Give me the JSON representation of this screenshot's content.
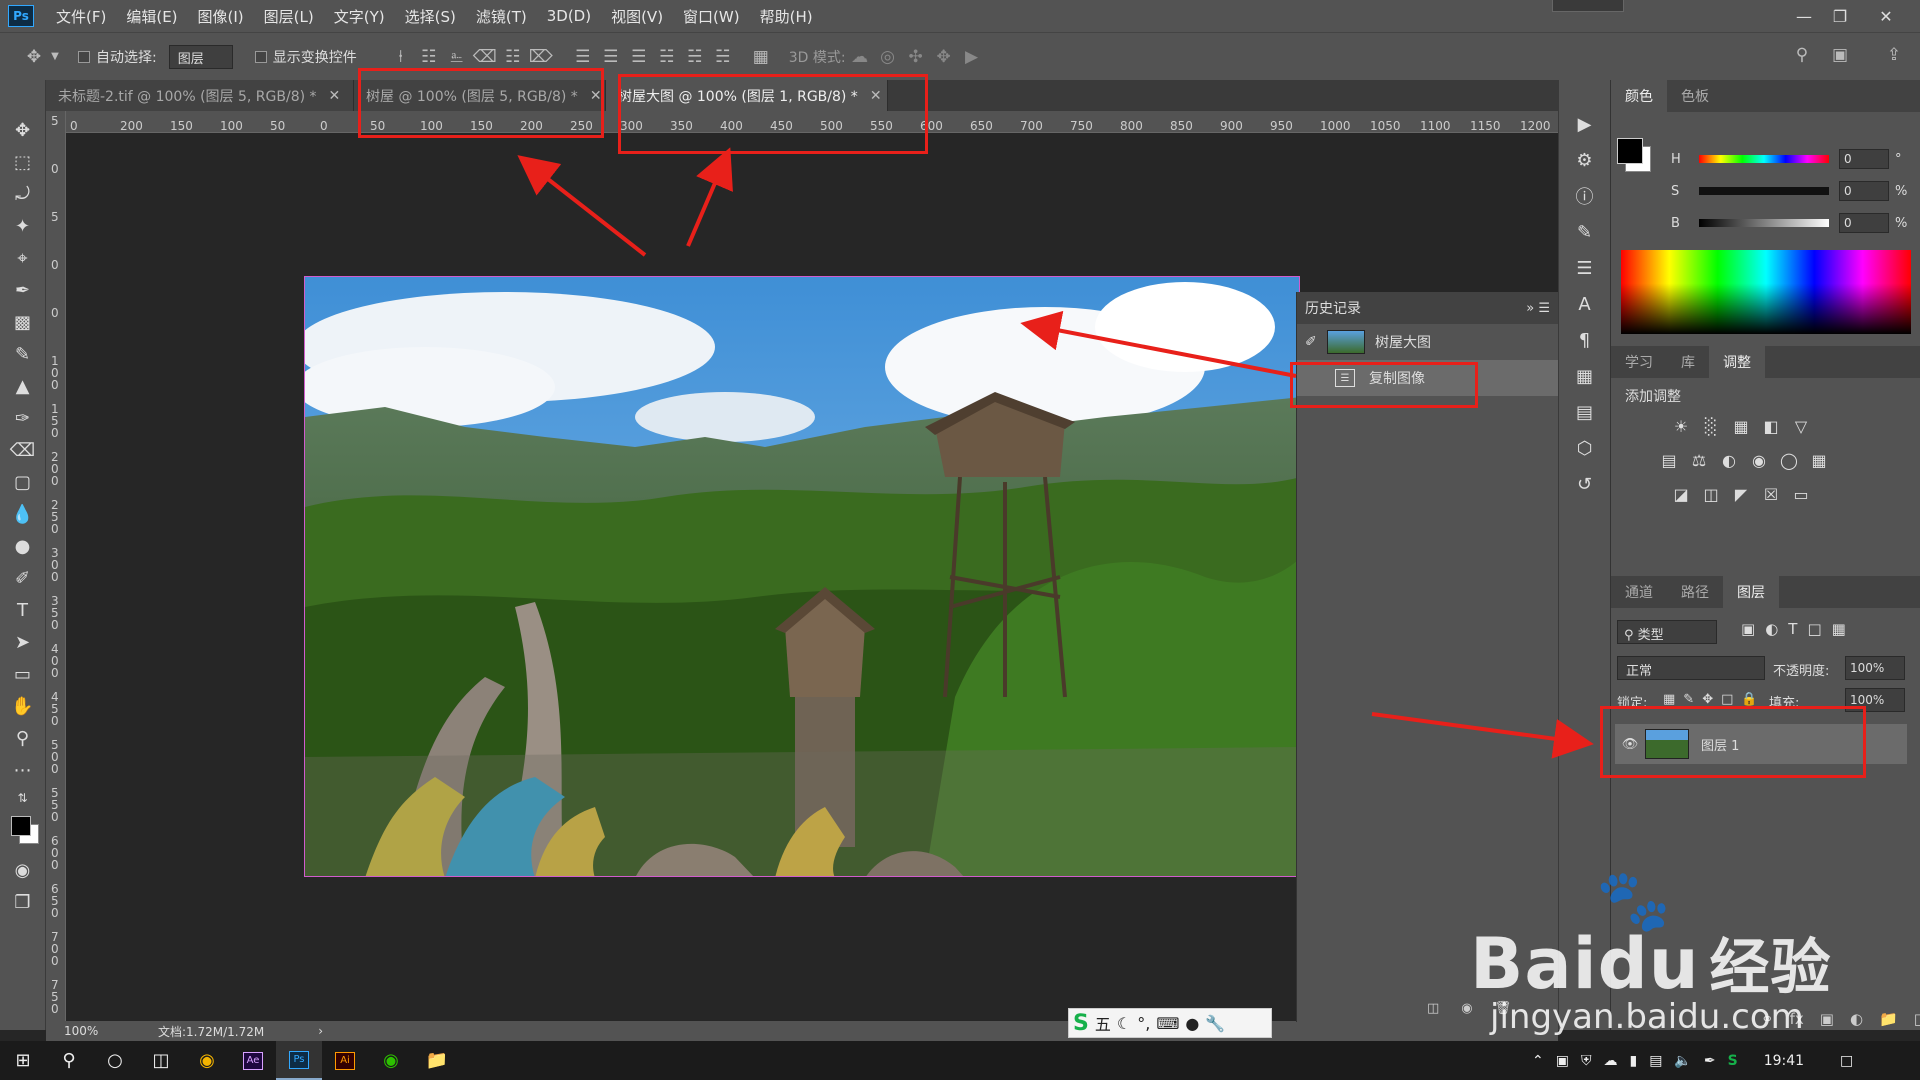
{
  "menubar": {
    "logo": "Ps",
    "items": [
      "文件(F)",
      "编辑(E)",
      "图像(I)",
      "图层(L)",
      "文字(Y)",
      "选择(S)",
      "滤镜(T)",
      "3D(D)",
      "视图(V)",
      "窗口(W)",
      "帮助(H)"
    ]
  },
  "optbar": {
    "auto_select_label": "自动选择:",
    "auto_select_value": "图层",
    "show_transform_label": "显示变换控件",
    "mode_3d_label": "3D 模式:"
  },
  "tabs": [
    {
      "label": "未标题-2.tif @ 100% (图层 5, RGB/8) *",
      "active": false
    },
    {
      "label": "树屋 @ 100% (图层 5, RGB/8) *",
      "active": false
    },
    {
      "label": "树屋大图 @ 100% (图层 1, RGB/8) *",
      "active": true
    }
  ],
  "ruler": {
    "h_ticks": [
      "0",
      "200",
      "150",
      "100",
      "50",
      "0",
      "50",
      "100",
      "150",
      "200",
      "250",
      "300",
      "350",
      "400",
      "450",
      "500",
      "550",
      "600",
      "650",
      "700",
      "750",
      "800",
      "850",
      "900",
      "950",
      "1000",
      "1050",
      "1100",
      "1150",
      "1200"
    ],
    "v_ticks": [
      "5",
      "0",
      "5",
      "0",
      "0",
      "1 0 0",
      "1 5 0",
      "2 0 0",
      "2 5 0",
      "3 0 0",
      "3 5 0",
      "4 0 0",
      "4 5 0",
      "5 0 0",
      "5 5 0",
      "6 0 0",
      "6 5 0",
      "7 0 0",
      "7 5 0"
    ]
  },
  "status": {
    "zoom": "100%",
    "doc": "文档:1.72M/1.72M"
  },
  "history": {
    "title": "历史记录",
    "items": [
      {
        "label": "树屋大图",
        "type": "snapshot"
      },
      {
        "label": "复制图像",
        "type": "step"
      }
    ]
  },
  "color_panel": {
    "tabs": [
      "颜色",
      "色板"
    ],
    "h_label": "H",
    "h_value": "0",
    "h_unit": "°",
    "s_label": "S",
    "s_value": "0",
    "s_unit": "%",
    "b_label": "B",
    "b_value": "0",
    "b_unit": "%"
  },
  "adjust_panel": {
    "tabs": [
      "学习",
      "库",
      "调整"
    ],
    "title": "添加调整"
  },
  "layers_panel": {
    "tabs": [
      "通道",
      "路径",
      "图层"
    ],
    "filter_label": "类型",
    "blend_mode": "正常",
    "opacity_label": "不透明度:",
    "opacity_value": "100%",
    "lock_label": "锁定:",
    "fill_label": "填充:",
    "fill_value": "100%",
    "layers": [
      {
        "name": "图层 1",
        "visible": true
      }
    ]
  },
  "taskbar": {
    "time": "19:41"
  },
  "ime": {
    "label": "五"
  },
  "watermark": {
    "brand": "Bai",
    "brand2": "du",
    "cn": "经验",
    "url": "jingyan.baidu.com"
  },
  "colors": {
    "annotation": "#e8201a",
    "ps_blue": "#31a8ff",
    "panel_bg": "#535353"
  }
}
